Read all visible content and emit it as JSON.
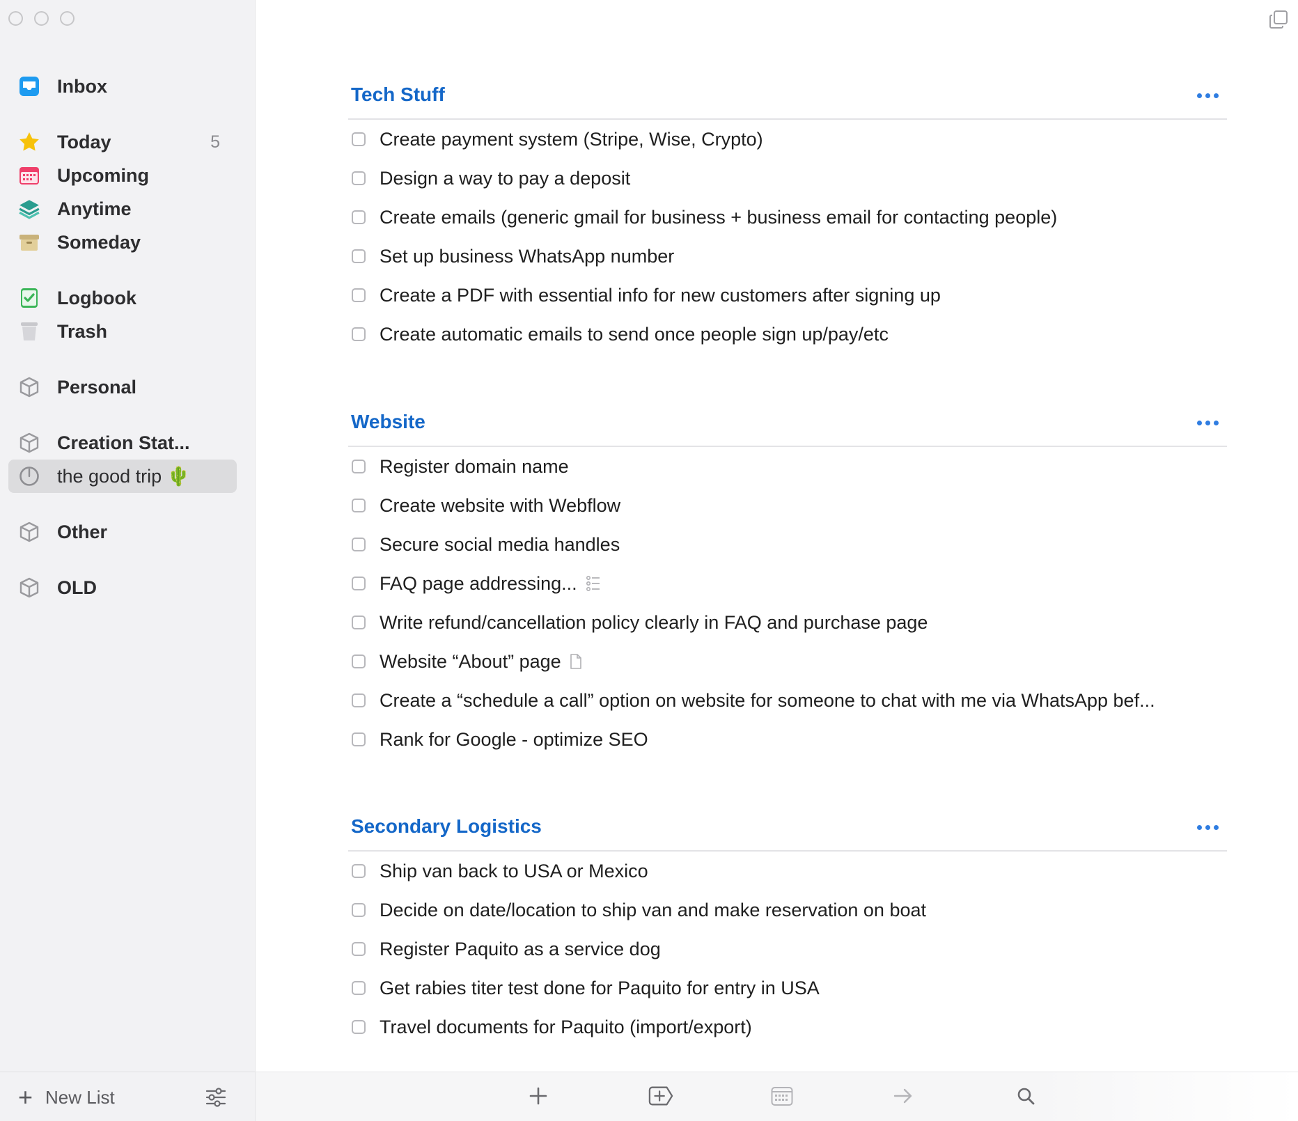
{
  "sidebar": {
    "inbox": {
      "label": "Inbox",
      "icon": "inbox-icon"
    },
    "today": {
      "label": "Today",
      "count": "5",
      "icon": "star-icon"
    },
    "upcoming": {
      "label": "Upcoming",
      "icon": "calendar-icon"
    },
    "anytime": {
      "label": "Anytime",
      "icon": "layers-icon"
    },
    "someday": {
      "label": "Someday",
      "icon": "archive-box-icon"
    },
    "logbook": {
      "label": "Logbook",
      "icon": "logbook-icon"
    },
    "trash": {
      "label": "Trash",
      "icon": "trash-icon"
    },
    "areas": [
      {
        "label": "Personal",
        "icon": "area-cube-icon"
      },
      {
        "label": "Creation Stat...",
        "icon": "area-cube-icon"
      },
      {
        "label": "the good trip 🌵",
        "icon": "project-progress-icon",
        "selected": true
      },
      {
        "label": "Other",
        "icon": "area-cube-icon"
      },
      {
        "label": "OLD",
        "icon": "area-cube-icon"
      }
    ],
    "footer": {
      "new_list_label": "New List",
      "plus": "+"
    }
  },
  "main": {
    "sections": [
      {
        "title": "Tech Stuff",
        "tasks": [
          "Create payment system (Stripe, Wise, Crypto)",
          "Design a way to pay a deposit",
          "Create emails (generic gmail for business + business email for contacting people)",
          "Set up business WhatsApp number",
          "Create a PDF with essential info for new customers after signing up",
          "Create automatic emails to send once people sign up/pay/etc"
        ]
      },
      {
        "title": "Website",
        "tasks": [
          "Register domain name",
          "Create website with Webflow",
          "Secure social media handles",
          "FAQ page addressing...",
          "Write refund/cancellation policy clearly in FAQ and purchase page",
          "Website “About” page",
          "Create a “schedule a call” option on website for someone to chat with me via WhatsApp bef...",
          "Rank for Google - optimize SEO"
        ]
      },
      {
        "title": "Secondary Logistics",
        "tasks": [
          "Ship van back to USA or Mexico",
          "Decide on date/location to ship van and make reservation on boat",
          "Register Paquito as a service dog",
          "Get rabies titer test done for Paquito for entry in USA",
          "Travel documents for Paquito (import/export)"
        ]
      }
    ]
  },
  "toolbar": {
    "buttons": [
      "plus-icon",
      "add-heading-icon",
      "calendar-icon",
      "arrow-right-icon",
      "search-icon"
    ]
  },
  "colors": {
    "accent": "#1467c8",
    "sidebar_bg": "#f2f2f4",
    "selected_bg": "#dcdcde"
  }
}
